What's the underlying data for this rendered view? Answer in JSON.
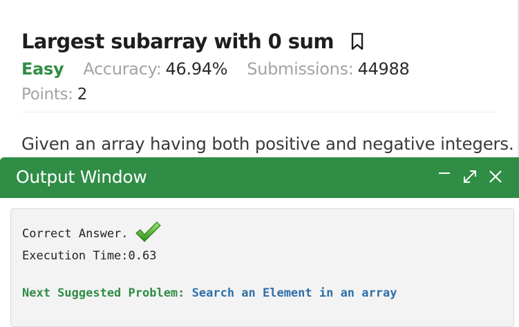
{
  "problem": {
    "title": "Largest subarray with 0 sum",
    "difficulty": "Easy",
    "accuracy_label": "Accuracy:",
    "accuracy_value": "46.94%",
    "submissions_label": "Submissions:",
    "submissions_value": "44988",
    "points_label": "Points:",
    "points_value": "2",
    "statement": "Given an array having both positive and negative integers.",
    "bookmark_icon": "bookmark-icon"
  },
  "output_window": {
    "title": "Output Window",
    "controls": [
      "minimize-icon",
      "expand-icon",
      "close-icon"
    ],
    "result_text": "Correct Answer.",
    "result_icon": "checkmark-icon",
    "execution_time": "Execution Time:0.63",
    "next_label": "Next Suggested Problem:",
    "next_problem": "Search an Element in an array"
  },
  "colors": {
    "brand_green": "#2f8d46",
    "link_blue": "#2f6fa8",
    "muted_text": "#a3a3a3",
    "console_bg": "#f3f3f3"
  }
}
